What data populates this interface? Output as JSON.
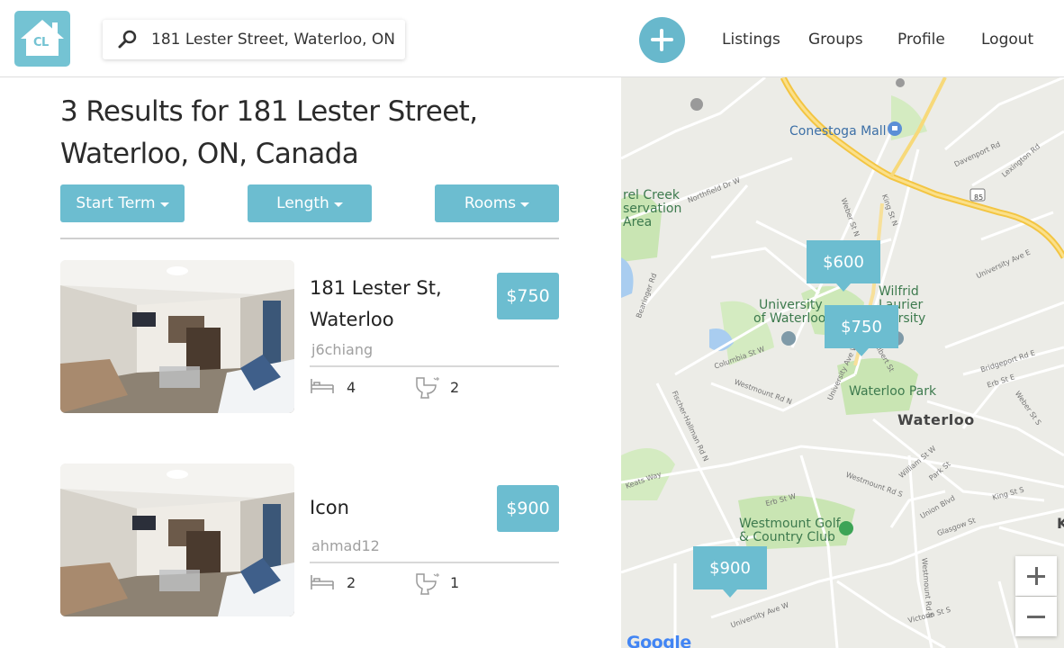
{
  "app": {
    "logo_text": "CL"
  },
  "search": {
    "value": "181 Lester Street, Waterloo, ON, Canada",
    "icon": "search-icon"
  },
  "nav": {
    "add_icon": "plus-icon",
    "links": [
      "Listings",
      "Groups",
      "Profile",
      "Logout"
    ]
  },
  "results": {
    "title_line1": "3 Results for 181 Lester Street,",
    "title_line2": "Waterloo, ON, Canada"
  },
  "filters": [
    "Start Term",
    "Length",
    "Rooms"
  ],
  "listings": [
    {
      "title_line1": "181 Lester St,",
      "title_line2": "Waterloo",
      "price": "$750",
      "user": "j6chiang",
      "beds": "4",
      "baths": "2"
    },
    {
      "title_line1": "Icon",
      "title_line2": "",
      "price": "$900",
      "user": "ahmad12",
      "beds": "2",
      "baths": "1"
    }
  ],
  "map": {
    "pins": [
      "$600",
      "$750",
      "$900"
    ],
    "labels": {
      "conestoga": "Conestoga Mall",
      "laurel_1": "rel Creek",
      "laurel_2": "servation",
      "laurel_3": "Area",
      "uw_1": "University",
      "uw_2": "of Waterloo",
      "wlu_1": "Wilfrid",
      "wlu_2": "Laurier",
      "wlu_3": "ersity",
      "park": "Waterloo Park",
      "city": "Waterloo",
      "golf_1": "Westmount Golf",
      "golf_2": "& Country Club",
      "edge_k": "K",
      "google": "Google"
    },
    "streets": {
      "northfield": "Northfield Dr W",
      "davenport": "Davenport Rd",
      "lexington": "Lexington Rd",
      "weber_n": "Weber St N",
      "king_n": "King St N",
      "university_e": "University Ave E",
      "bearinger": "Bearinger Rd",
      "columbia": "Columbia St W",
      "albert": "Albert St",
      "university_w": "University Ave W",
      "westmount": "Westmount Rd N",
      "bridgeport": "Bridgeport Rd E",
      "erb_e": "Erb St E",
      "weber_s": "Weber St S",
      "fischer": "Fischer-Hallman Rd N",
      "keats": "Keats Way",
      "erb_w": "Erb St W",
      "william": "William St W",
      "park": "Park St",
      "westmount_s": "Westmount Rd S",
      "union": "Union Blvd",
      "king_s": "King St S",
      "glasgow": "Glasgow St",
      "university_w2": "University Ave W",
      "victoria": "Victoria St S",
      "westmount_n2": "Westmount Rd N",
      "hwy85": "85"
    },
    "zoom_in": "zoom-in-icon",
    "zoom_out": "zoom-out-icon"
  },
  "colors": {
    "accent": "#6cbdd0",
    "logo": "#74c3d3",
    "map_road_major": "#f7d26b",
    "map_park": "#c8e6b4"
  }
}
